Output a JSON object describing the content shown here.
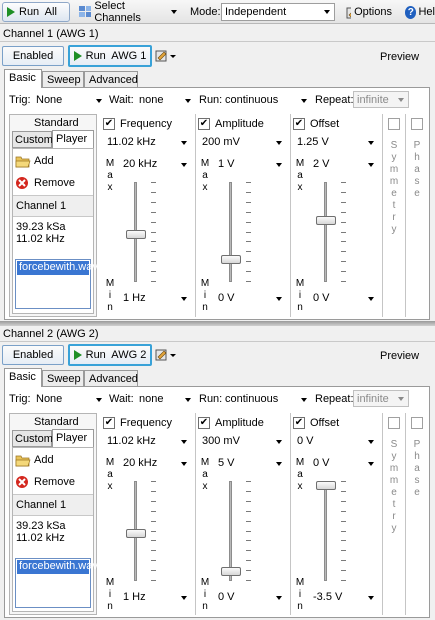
{
  "toolbar": {
    "run_all": "Run  All",
    "select_channels": "Select Channels",
    "mode_label": "Mode:",
    "mode_value": "Independent",
    "options": "Options",
    "help": "Hel"
  },
  "channels": [
    {
      "header": "Channel 1 (AWG 1)",
      "enabled_label": "Enabled",
      "run_label": "Run  AWG 1",
      "preview_label": "Preview",
      "tabs": [
        "Basic",
        "Sweep",
        "Advanced"
      ],
      "trig_label": "Trig:",
      "trig_value": "None",
      "wait_label": "Wait:",
      "wait_value": "none",
      "run_mode_label": "Run:",
      "run_mode_value": "continuous",
      "repeat_label": "Repeat:",
      "repeat_value": "infinite",
      "waveform": {
        "standard_label": "Standard",
        "custom_label": "Custom",
        "player_label": "Player",
        "add_label": "Add",
        "remove_label": "Remove",
        "channel_label": "Channel 1",
        "sample_rate": "39.23 kSa",
        "frequency": "11.02 kHz",
        "file": "forcebewith.wav"
      },
      "params": [
        {
          "name": "Frequency",
          "value": "11.02 kHz",
          "max": "20 kHz",
          "min": "1 Hz",
          "level": 0.47
        },
        {
          "name": "Amplitude",
          "value": "200 mV",
          "max": "1 V",
          "min": "0 V",
          "level": 0.2
        },
        {
          "name": "Offset",
          "value": "1.25 V",
          "max": "2 V",
          "min": "0 V",
          "level": 0.63
        }
      ]
    },
    {
      "header": "Channel 2 (AWG 2)",
      "enabled_label": "Enabled",
      "run_label": "Run  AWG 2",
      "preview_label": "Preview",
      "tabs": [
        "Basic",
        "Sweep",
        "Advanced"
      ],
      "trig_label": "Trig:",
      "trig_value": "None",
      "wait_label": "Wait:",
      "wait_value": "none",
      "run_mode_label": "Run:",
      "run_mode_value": "continuous",
      "repeat_label": "Repeat:",
      "repeat_value": "infinite",
      "waveform": {
        "standard_label": "Standard",
        "custom_label": "Custom",
        "player_label": "Player",
        "add_label": "Add",
        "remove_label": "Remove",
        "channel_label": "Channel 1",
        "sample_rate": "39.23 kSa",
        "frequency": "11.02 kHz",
        "file": "forcebewith.wav"
      },
      "params": [
        {
          "name": "Frequency",
          "value": "11.02 kHz",
          "max": "20 kHz",
          "min": "1 Hz",
          "level": 0.47
        },
        {
          "name": "Amplitude",
          "value": "300 mV",
          "max": "5 V",
          "min": "0 V",
          "level": 0.06
        },
        {
          "name": "Offset",
          "value": "0 V",
          "max": "0 V",
          "min": "-3.5 V",
          "level": 1.0
        }
      ]
    }
  ],
  "side_labels": {
    "max_letters": [
      "M",
      "a",
      "x"
    ],
    "min_letters": [
      "M",
      "i",
      "n"
    ],
    "symmetry_letters": [
      "S",
      "y",
      "m",
      "m",
      "e",
      "t",
      "r",
      "y"
    ],
    "phase_letters": [
      "P",
      "h",
      "a",
      "s",
      "e"
    ]
  },
  "colors": {
    "run_green": "#1e8f25",
    "remove_red": "#d4271e",
    "selection_blue": "#3a76d2"
  }
}
